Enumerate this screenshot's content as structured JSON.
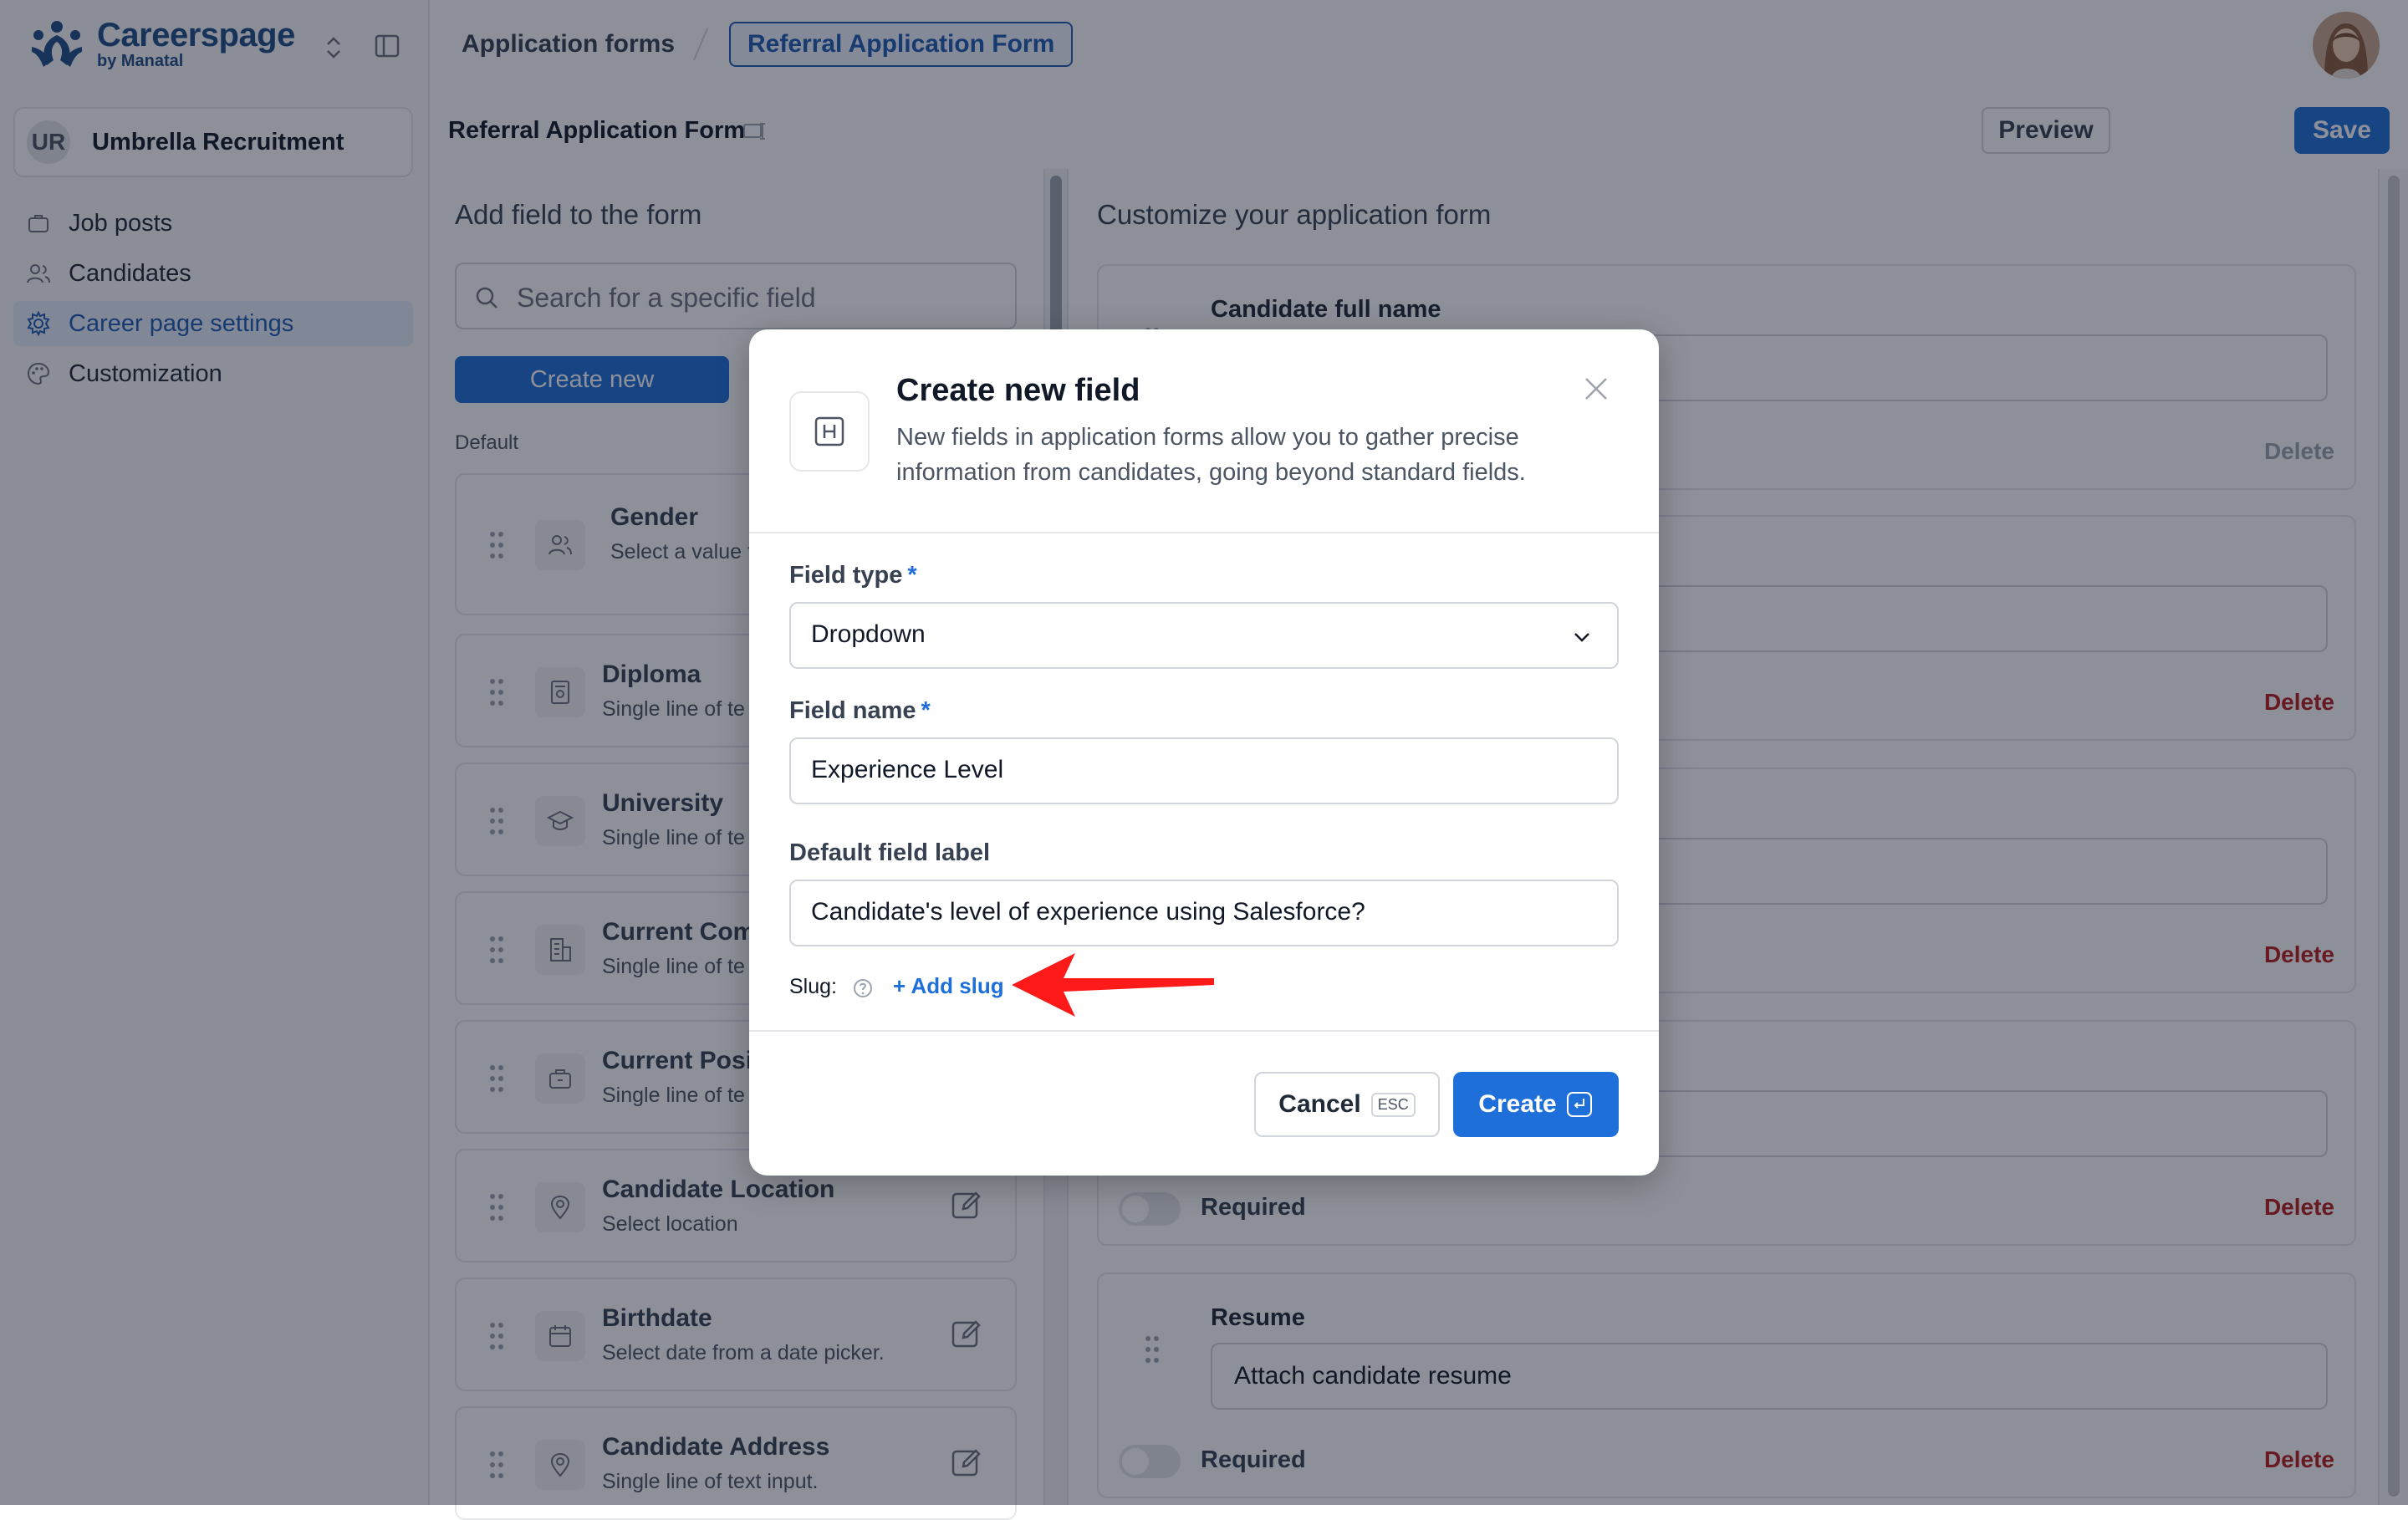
{
  "brand": {
    "name": "Careerspage",
    "sub": "by Manatal",
    "color": "#1d4e89"
  },
  "sidebar": {
    "org": {
      "initials": "UR",
      "name": "Umbrella Recruitment"
    },
    "items": [
      {
        "label": "Job posts",
        "icon": "briefcase-icon"
      },
      {
        "label": "Candidates",
        "icon": "users-icon"
      },
      {
        "label": "Career page settings",
        "icon": "gear-icon",
        "active": true
      },
      {
        "label": "Customization",
        "icon": "palette-icon"
      }
    ]
  },
  "header": {
    "breadcrumb": [
      "Application forms",
      "Referral Application Form"
    ]
  },
  "subheader": {
    "form_title": "Referral Application Form",
    "preview_label": "Preview",
    "save_label": "Save"
  },
  "left_panel": {
    "title": "Add field to the form",
    "search_placeholder": "Search for a specific field",
    "create_new_label": "Create new",
    "section_label": "Default",
    "fields": [
      {
        "title": "Gender",
        "desc": "Select a value f options."
      },
      {
        "title": "Diploma",
        "desc": "Single line of te"
      },
      {
        "title": "University",
        "desc": "Single line of te"
      },
      {
        "title": "Current Com",
        "desc": "Single line of te"
      },
      {
        "title": "Current Posi",
        "desc": "Single line of te"
      },
      {
        "title": "Candidate Location",
        "desc": "Select location"
      },
      {
        "title": "Birthdate",
        "desc": "Select date from a date picker."
      },
      {
        "title": "Candidate Address",
        "desc": "Single line of text input."
      }
    ]
  },
  "right_panel": {
    "title": "Customize your application form",
    "cards": [
      {
        "label": "Candidate full name",
        "value": "",
        "delete": "Delete"
      },
      {
        "label": "",
        "value": "",
        "delete": "Delete"
      },
      {
        "label": "",
        "value": "",
        "delete": "Delete"
      },
      {
        "label": "",
        "value": "",
        "required": "Required",
        "delete": "Delete"
      },
      {
        "label": "Resume",
        "value": "Attach candidate resume",
        "required": "Required",
        "delete": "Delete"
      }
    ]
  },
  "modal": {
    "title": "Create new field",
    "description": "New fields in application forms allow you to gather precise information from candidates, going beyond standard fields.",
    "field_type": {
      "label": "Field type",
      "required_mark": "*",
      "value": "Dropdown"
    },
    "field_name": {
      "label": "Field name",
      "required_mark": "*",
      "value": "Experience Level"
    },
    "default_label": {
      "label": "Default field label",
      "value": "Candidate's level of experience using Salesforce?"
    },
    "slug": {
      "label": "Slug:",
      "add_label": "+ Add slug"
    },
    "cancel": {
      "label": "Cancel",
      "kbd": "ESC"
    },
    "create": {
      "label": "Create"
    }
  },
  "colors": {
    "accent": "#1e6fd9",
    "danger": "#b91c1c",
    "annotation_arrow": "#ff1a1a"
  }
}
